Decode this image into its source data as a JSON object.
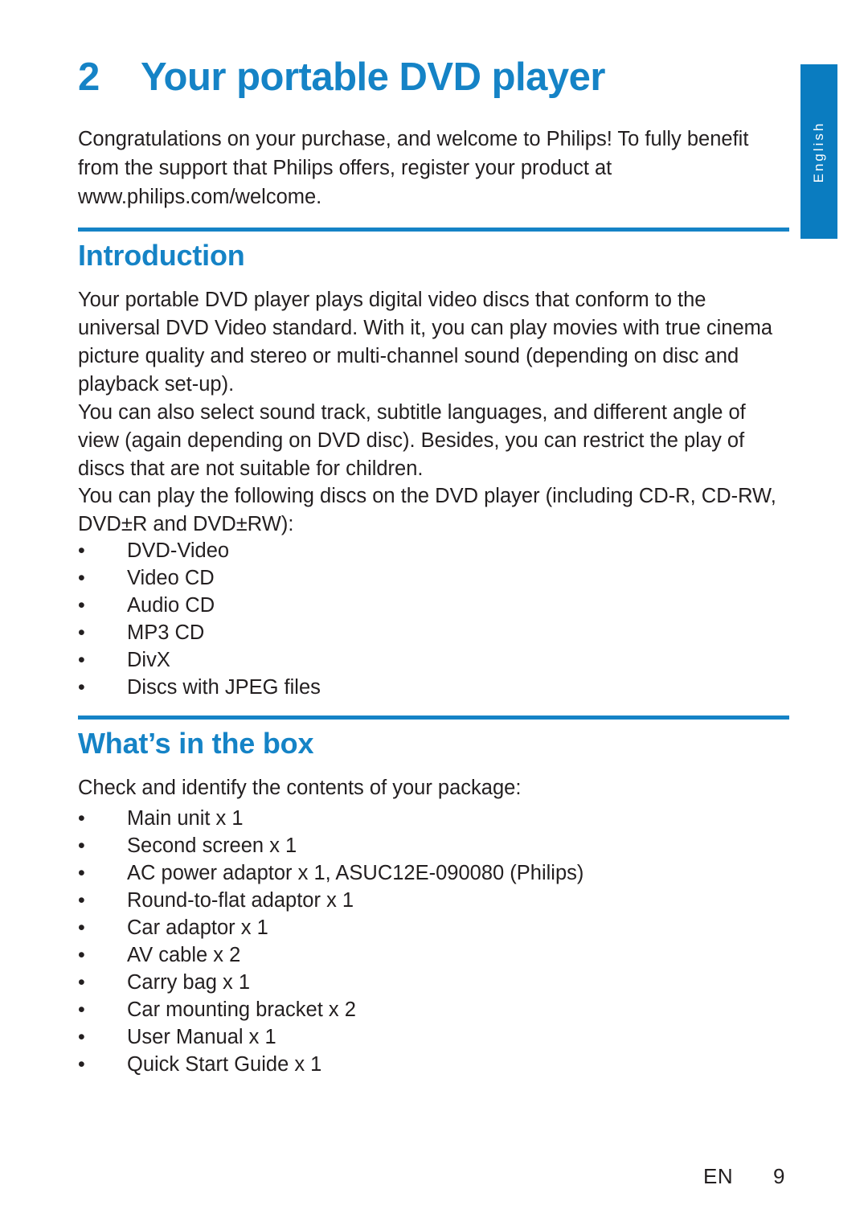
{
  "page": {
    "language_tab": "English",
    "accent_color": "#1583c6",
    "tab_color": "#0a7cc0",
    "text_color": "#231f20"
  },
  "chapter": {
    "number": "2",
    "title": "Your portable DVD player"
  },
  "lead_paragraph": "Congratulations on your purchase, and welcome to Philips! To fully benefit from the support that Philips offers, register your product at www.philips.com/welcome.",
  "sections": [
    {
      "heading": "Introduction",
      "paragraphs": [
        "Your portable DVD player plays digital video discs that conform to the universal DVD Video standard. With it, you can play movies with true cinema picture quality and stereo or multi-channel sound (depending on disc and playback set-up).",
        "You can also select sound track, subtitle languages, and different angle of view (again depending on DVD disc). Besides, you can restrict the play of discs that are not suitable for children.",
        "You can play the following discs on the DVD player (including CD-R, CD-RW, DVD±R and DVD±RW):"
      ],
      "bullets": [
        "DVD-Video",
        "Video CD",
        "Audio CD",
        "MP3 CD",
        "DivX",
        "Discs with JPEG files"
      ]
    },
    {
      "heading": "What’s in the box",
      "paragraphs": [
        "Check and identify the contents of your package:"
      ],
      "bullets": [
        "Main unit x 1",
        "Second screen x 1",
        "AC power adaptor x 1, ASUC12E-090080 (Philips)",
        "Round-to-flat adaptor x 1",
        "Car adaptor x 1",
        "AV cable x 2",
        "Carry bag x 1",
        "Car mounting bracket x 2",
        "User Manual x 1",
        "Quick Start Guide x 1"
      ]
    }
  ],
  "bullet_glyph": "•",
  "footer": {
    "language_code": "EN",
    "page_number": "9"
  }
}
